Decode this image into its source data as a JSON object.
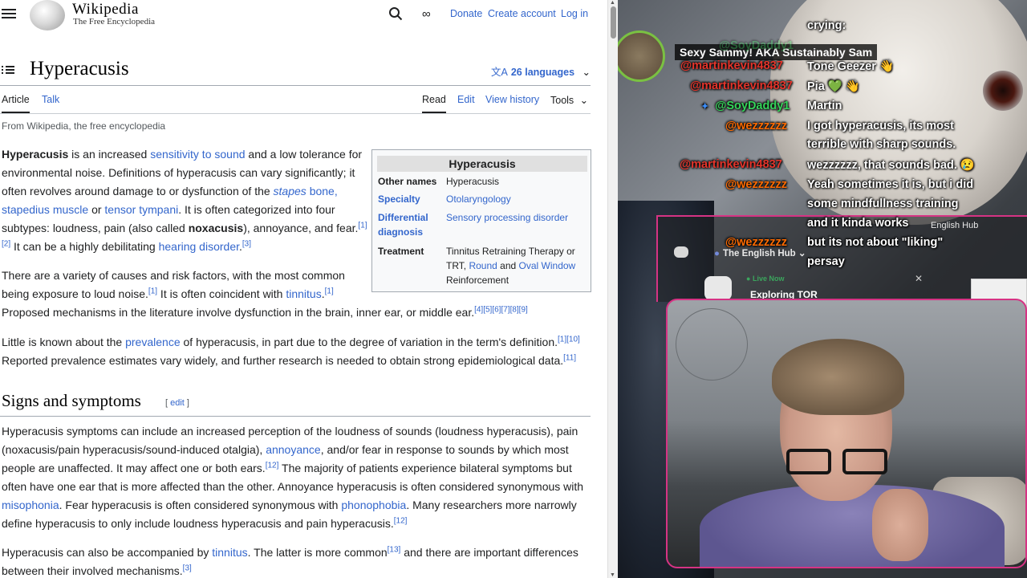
{
  "wiki": {
    "logo_wordmark": "Wikipedia",
    "logo_tagline": "The Free Encyclopedia",
    "header_links": [
      "Donate",
      "Create account",
      "Log in"
    ],
    "page_title": "Hyperacusis",
    "languages": "26 languages",
    "tabs_left": [
      "Article",
      "Talk"
    ],
    "tabs_right": [
      "Read",
      "Edit",
      "View history",
      "Tools"
    ],
    "from_line": "From Wikipedia, the free encyclopedia",
    "infobox": {
      "title": "Hyperacusis",
      "rows": [
        {
          "key": "Other names",
          "value": "Hyperacusis"
        },
        {
          "key": "Specialty",
          "value": "Otolaryngology"
        },
        {
          "key": "Differential diagnosis",
          "value": "Sensory processing disorder"
        },
        {
          "key": "Treatment",
          "value_parts": [
            "Tinnitus Retraining Therapy or TRT, ",
            "Round",
            " and ",
            "Oval Window",
            " Reinforcement"
          ]
        }
      ]
    },
    "intro": {
      "p1_lines": [
        "is an increased",
        "sensitivity to sound",
        "and a low tolerance",
        "for environmental noise. Definitions of hyperacusis can vary",
        "significantly; it often revolves around damage to or dysfunction of the",
        "stapes",
        "bone,",
        "stapedius muscle",
        "or",
        "tensor tympani",
        ". It is often categorized",
        "into four subtypes: loudness, pain (also called",
        "noxacusis",
        "), annoyance,",
        "and fear.",
        "[1][2]",
        " It can be a highly debilitating",
        "hearing disorder",
        "[3]"
      ],
      "bold_term": "Hyperacusis",
      "p2_lines": [
        "There are a variety of causes and risk factors, with the most common",
        "being exposure to loud noise.",
        "[1]",
        " It is often coincident with",
        "tinnitus",
        "[1]",
        "Proposed mechanisms in the literature involve dysfunction in the brain, inner ear, or middle ear.",
        "[4][5][6][7][8][9]"
      ],
      "p3_lines": [
        "Little is known about the",
        "prevalence",
        "of hyperacusis, in part due to the degree of variation in the term's definition.",
        "[1][10]",
        "Reported prevalence estimates vary widely, and further research is needed to obtain strong epidemiological data.",
        "[11]"
      ]
    },
    "section_title": "Signs and symptoms",
    "edit_label": "edit",
    "sec_p1": {
      "l1": "Hyperacusis symptoms can include an increased perception of the loudness of sounds (loudness hyperacusis), pain",
      "l2a": "(noxacusis/pain hyperacusis/sound-induced otalgia),",
      "l2link": "annoyance",
      "l2b": ", and/or fear in response to sounds by which most",
      "l3a": "people are unaffected. It may affect one or both ears.",
      "l3sup": "[12]",
      "l3b": " The majority of patients experience bilateral symptoms but",
      "l4": "often have one ear that is more affected than the other. Annoyance hyperacusis is often considered synonymous with",
      "l5link1": "misophonia",
      "l5a": ". Fear hyperacusis is often considered synonymous with",
      "l5link2": "phonophobia",
      "l5b": ". Many researchers more narrowly",
      "l6": "define hyperacusis to only include loudness hyperacusis and pain hyperacusis.",
      "l6sup": "[12]"
    },
    "sec_p2": {
      "l1a": "Hyperacusis can also be accompanied by",
      "l1link": "tinnitus",
      "l1b": ". The latter is more common",
      "l1sup": "[13]",
      "l1c": " and there are important differences",
      "l2": "between their involved mechanisms.",
      "l2sup": "[3]"
    }
  },
  "stream": {
    "title_banner": "Sexy Sammy! AKA Sustainably Sam",
    "chat": [
      {
        "user": "",
        "text": "crying:"
      },
      {
        "user": "@SoyDaddy1",
        "text": "",
        "color": "green"
      },
      {
        "user": "@martinkevin4837",
        "text": "Tone Geezer 👋",
        "color": "red"
      },
      {
        "user": "@martinkevin4837",
        "text": "Pia 💚 👋",
        "color": "red"
      },
      {
        "user": "@SoyDaddy1",
        "text": "Martin",
        "color": "green"
      },
      {
        "user": "@wezzzzzz",
        "text": "I got hyperacusis, its most",
        "color": "orange"
      },
      {
        "user": "",
        "text": "terrible with sharp sounds."
      },
      {
        "user": "@martinkevin4837",
        "text": "wezzzzzz, that sounds bad. 😢",
        "color": "red"
      },
      {
        "user": "@wezzzzzz",
        "text": "Yeah sometimes it is, but i did",
        "color": "orange"
      },
      {
        "user": "",
        "text": "some mindfullness training"
      },
      {
        "user": "",
        "text": "and it kinda works"
      },
      {
        "user": "@wezzzzzz",
        "text": "but its not about \"liking\"",
        "color": "orange"
      },
      {
        "user": "",
        "text": "persay"
      }
    ],
    "discord": {
      "server": "The English Hub",
      "hub_label": "English Hub",
      "live": "Live Now",
      "stream_name": "Exploring TOR"
    }
  },
  "colors": {
    "link": "#3366cc",
    "text": "#202122",
    "chat_red": "#e4342b",
    "chat_orange": "#ff6a00",
    "chat_green": "#35d45a",
    "overlay_pink": "#d63384"
  }
}
